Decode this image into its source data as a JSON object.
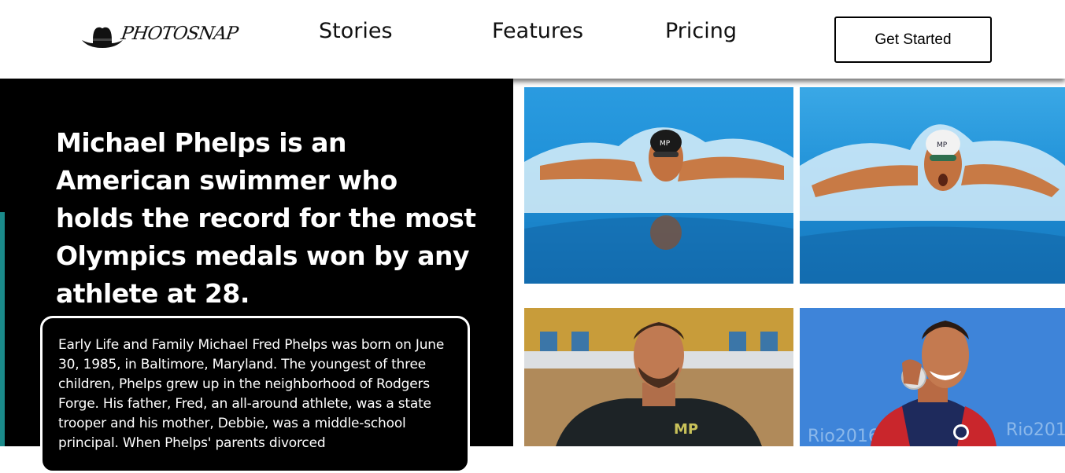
{
  "header": {
    "logo_text": "PHOTOSNAP",
    "nav": [
      {
        "label": "Stories"
      },
      {
        "label": "Features"
      },
      {
        "label": "Pricing"
      }
    ],
    "cta_label": "Get Started"
  },
  "hero": {
    "title": "Michael Phelps is an American swimmer who holds the record for the most Olympics medals won by any athlete at 28.",
    "story": "Early Life and Family Michael Fred Phelps was born on June 30, 1985, in Baltimore, Maryland. The youngest of three children, Phelps grew up in the neighborhood of Rodgers Forge. His father, Fred, an all-around athlete, was a state trooper and his mother, Debbie, was a middle-school principal. When Phelps' parents divorced"
  },
  "gallery": {
    "items": [
      {
        "name": "butterfly-stroke-photo-1"
      },
      {
        "name": "butterfly-stroke-photo-2"
      },
      {
        "name": "portrait-photo"
      },
      {
        "name": "medal-photo"
      }
    ],
    "cap_text": "MP",
    "shirt_logo": "MP",
    "backdrop_text": "Rio2016"
  },
  "colors": {
    "hero_bg": "#000000",
    "accent": "#1a8a8a",
    "pool": "#1e8fd6"
  }
}
